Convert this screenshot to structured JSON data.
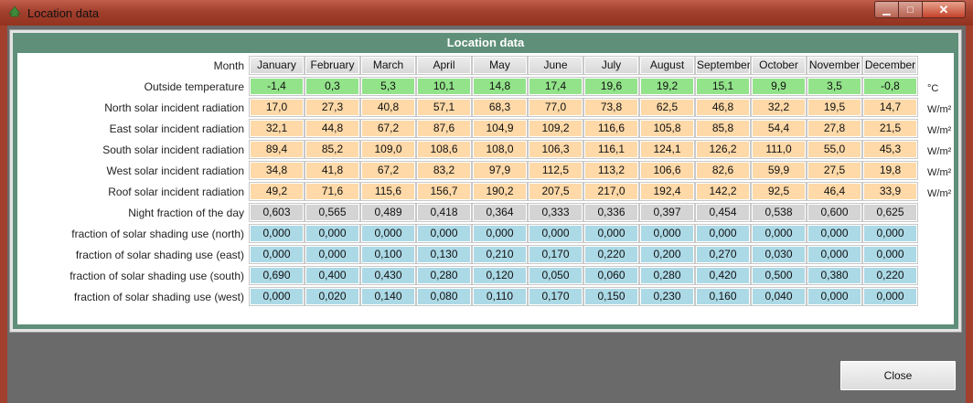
{
  "window": {
    "title": "Location data",
    "minimize_label": "▁",
    "maximize_label": "□",
    "close_label": "✕"
  },
  "panel": {
    "title": "Location data"
  },
  "table": {
    "month_label": "Month",
    "months": [
      "January",
      "February",
      "March",
      "April",
      "May",
      "June",
      "July",
      "August",
      "September",
      "October",
      "November",
      "December"
    ],
    "rows": [
      {
        "label": "Outside temperature",
        "unit": "°C",
        "kind": "temp",
        "values": [
          "-1,4",
          "0,3",
          "5,3",
          "10,1",
          "14,8",
          "17,4",
          "19,6",
          "19,2",
          "15,1",
          "9,9",
          "3,5",
          "-0,8"
        ]
      },
      {
        "label": "North solar incident radiation",
        "unit": "W/m²",
        "kind": "rad",
        "values": [
          "17,0",
          "27,3",
          "40,8",
          "57,1",
          "68,3",
          "77,0",
          "73,8",
          "62,5",
          "46,8",
          "32,2",
          "19,5",
          "14,7"
        ]
      },
      {
        "label": "East solar incident radiation",
        "unit": "W/m²",
        "kind": "rad",
        "values": [
          "32,1",
          "44,8",
          "67,2",
          "87,6",
          "104,9",
          "109,2",
          "116,6",
          "105,8",
          "85,8",
          "54,4",
          "27,8",
          "21,5"
        ]
      },
      {
        "label": "South solar incident radiation",
        "unit": "W/m²",
        "kind": "rad",
        "values": [
          "89,4",
          "85,2",
          "109,0",
          "108,6",
          "108,0",
          "106,3",
          "116,1",
          "124,1",
          "126,2",
          "111,0",
          "55,0",
          "45,3"
        ]
      },
      {
        "label": "West solar incident radiation",
        "unit": "W/m²",
        "kind": "rad",
        "values": [
          "34,8",
          "41,8",
          "67,2",
          "83,2",
          "97,9",
          "112,5",
          "113,2",
          "106,6",
          "82,6",
          "59,9",
          "27,5",
          "19,8"
        ]
      },
      {
        "label": "Roof solar incident radiation",
        "unit": "W/m²",
        "kind": "rad",
        "values": [
          "49,2",
          "71,6",
          "115,6",
          "156,7",
          "190,2",
          "207,5",
          "217,0",
          "192,4",
          "142,2",
          "92,5",
          "46,4",
          "33,9"
        ]
      },
      {
        "label": "Night fraction of the day",
        "unit": "",
        "kind": "night",
        "values": [
          "0,603",
          "0,565",
          "0,489",
          "0,418",
          "0,364",
          "0,333",
          "0,336",
          "0,397",
          "0,454",
          "0,538",
          "0,600",
          "0,625"
        ]
      },
      {
        "label": "fraction of solar shading use (north)",
        "unit": "",
        "kind": "shade",
        "values": [
          "0,000",
          "0,000",
          "0,000",
          "0,000",
          "0,000",
          "0,000",
          "0,000",
          "0,000",
          "0,000",
          "0,000",
          "0,000",
          "0,000"
        ]
      },
      {
        "label": "fraction of solar shading use (east)",
        "unit": "",
        "kind": "shade",
        "values": [
          "0,000",
          "0,000",
          "0,100",
          "0,130",
          "0,210",
          "0,170",
          "0,220",
          "0,200",
          "0,270",
          "0,030",
          "0,000",
          "0,000"
        ]
      },
      {
        "label": "fraction of solar shading use (south)",
        "unit": "",
        "kind": "shade",
        "values": [
          "0,690",
          "0,400",
          "0,430",
          "0,280",
          "0,120",
          "0,050",
          "0,060",
          "0,280",
          "0,420",
          "0,500",
          "0,380",
          "0,220"
        ]
      },
      {
        "label": "fraction of solar shading use (west)",
        "unit": "",
        "kind": "shade",
        "values": [
          "0,000",
          "0,020",
          "0,140",
          "0,080",
          "0,110",
          "0,170",
          "0,150",
          "0,230",
          "0,160",
          "0,040",
          "0,000",
          "0,000"
        ]
      }
    ]
  },
  "footer": {
    "close_label": "Close"
  },
  "colors": {
    "titlebar": "#a2402e",
    "panel_header": "#5f8f79",
    "temp_cell": "#92e38a",
    "radiation_cell": "#ffd9a8",
    "night_cell": "#d4d4d4",
    "shading_cell": "#acd9e6"
  },
  "icons": {
    "app": "tree-icon"
  }
}
